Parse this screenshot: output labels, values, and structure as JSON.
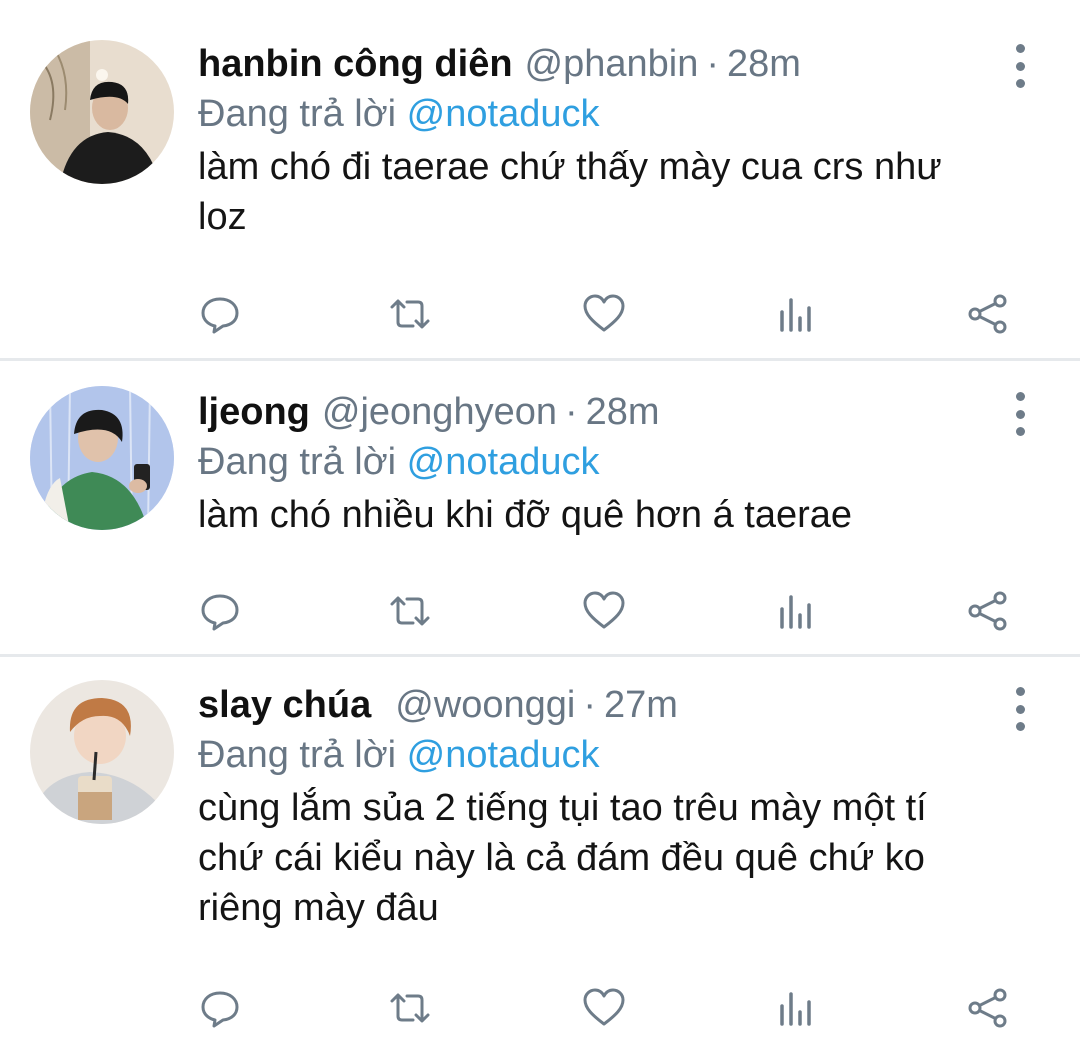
{
  "tweets": [
    {
      "display_name": "hanbin công diên",
      "handle": "@phanbin",
      "separator": "·",
      "time": "28m",
      "reply_prefix": "Đang trả lời",
      "reply_to": "@notaduck",
      "text": "làm chó đi taerae chứ thấy mày cua crs như\nloz"
    },
    {
      "display_name": "ljeong",
      "handle": "@jeonghyeon",
      "separator": "·",
      "time": "28m",
      "reply_prefix": "Đang trả lời",
      "reply_to": "@notaduck",
      "text": "làm chó nhiều khi đỡ quê hơn á taerae"
    },
    {
      "display_name": "slay chúa",
      "handle": "@woonggi",
      "separator": "·",
      "time": "27m",
      "reply_prefix": "Đang trả lời",
      "reply_to": "@notaduck",
      "text": "cùng lắm sủa 2 tiếng tụi tao trêu mày một tí\nchứ cái kiểu này là cả đám đều quê chứ ko\nriêng mày đâu"
    }
  ],
  "icons": {
    "reply": "reply-icon",
    "retweet": "retweet-icon",
    "like": "heart-icon",
    "views": "analytics-icon",
    "share": "share-icon",
    "more": "more-vertical-icon"
  },
  "colors": {
    "mention": "#2f9fe0",
    "secondary_text": "#687684",
    "icon": "#6e7c89",
    "divider": "#e6e9ec"
  }
}
